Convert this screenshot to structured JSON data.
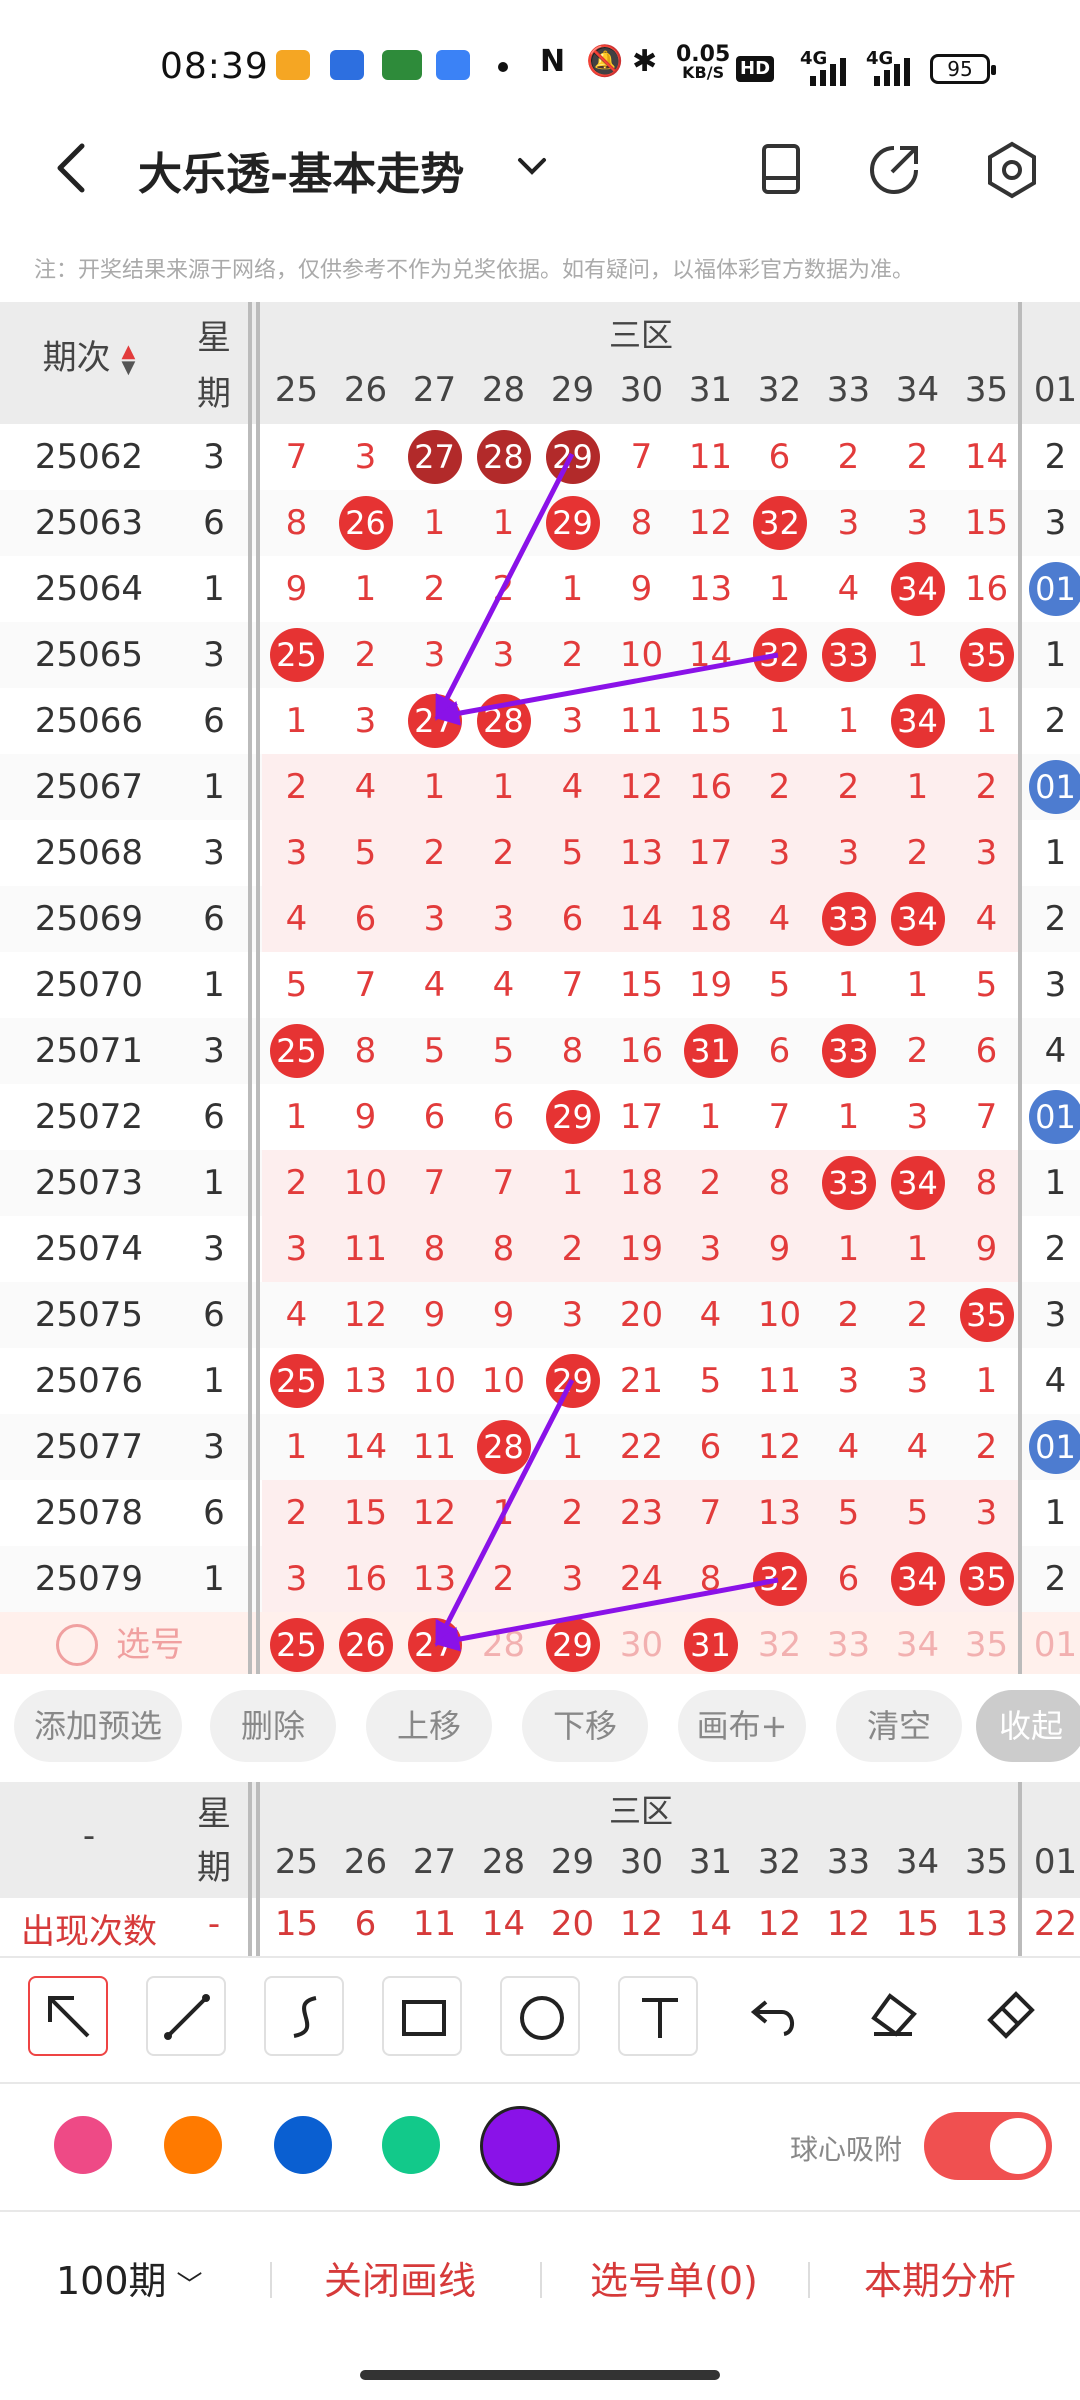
{
  "status_bar": {
    "time": "08:39",
    "net_speed_top": "0.05",
    "net_speed_bottom": "KB/S",
    "battery": "95",
    "hd": "HD",
    "signal1": "4G",
    "signal2": "4G"
  },
  "header": {
    "title": "大乐透-基本走势"
  },
  "notice": "注：开奖结果来源于网络，仅供参考不作为兑奖依据。如有疑问，以福体彩官方数据为准。",
  "table": {
    "col_issue": "期次",
    "col_week_1": "星",
    "col_week_2": "期",
    "zone": "三区",
    "columns": [
      "25",
      "26",
      "27",
      "28",
      "29",
      "30",
      "31",
      "32",
      "33",
      "34",
      "35",
      "01"
    ],
    "rows": [
      {
        "issue": "25062",
        "week": "3",
        "cells": [
          "7",
          "3",
          "27",
          "28",
          "29",
          "7",
          "11",
          "6",
          "2",
          "2",
          "14",
          "2"
        ]
      },
      {
        "issue": "25063",
        "week": "6",
        "cells": [
          "8",
          "26",
          "1",
          "1",
          "29",
          "8",
          "12",
          "32",
          "3",
          "3",
          "15",
          "3"
        ]
      },
      {
        "issue": "25064",
        "week": "1",
        "cells": [
          "9",
          "1",
          "2",
          "2",
          "1",
          "9",
          "13",
          "1",
          "4",
          "34",
          "16",
          "01"
        ]
      },
      {
        "issue": "25065",
        "week": "3",
        "cells": [
          "25",
          "2",
          "3",
          "3",
          "2",
          "10",
          "14",
          "32",
          "33",
          "1",
          "35",
          "1"
        ]
      },
      {
        "issue": "25066",
        "week": "6",
        "cells": [
          "1",
          "3",
          "27",
          "28",
          "3",
          "11",
          "15",
          "1",
          "1",
          "34",
          "1",
          "2"
        ]
      },
      {
        "issue": "25067",
        "week": "1",
        "cells": [
          "2",
          "4",
          "1",
          "1",
          "4",
          "12",
          "16",
          "2",
          "2",
          "1",
          "2",
          "01"
        ]
      },
      {
        "issue": "25068",
        "week": "3",
        "cells": [
          "3",
          "5",
          "2",
          "2",
          "5",
          "13",
          "17",
          "3",
          "3",
          "2",
          "3",
          "1"
        ]
      },
      {
        "issue": "25069",
        "week": "6",
        "cells": [
          "4",
          "6",
          "3",
          "3",
          "6",
          "14",
          "18",
          "4",
          "33",
          "34",
          "4",
          "2"
        ]
      },
      {
        "issue": "25070",
        "week": "1",
        "cells": [
          "5",
          "7",
          "4",
          "4",
          "7",
          "15",
          "19",
          "5",
          "1",
          "1",
          "5",
          "3"
        ]
      },
      {
        "issue": "25071",
        "week": "3",
        "cells": [
          "25",
          "8",
          "5",
          "5",
          "8",
          "16",
          "31",
          "6",
          "33",
          "2",
          "6",
          "4"
        ]
      },
      {
        "issue": "25072",
        "week": "6",
        "cells": [
          "1",
          "9",
          "6",
          "6",
          "29",
          "17",
          "1",
          "7",
          "1",
          "3",
          "7",
          "01"
        ]
      },
      {
        "issue": "25073",
        "week": "1",
        "cells": [
          "2",
          "10",
          "7",
          "7",
          "1",
          "18",
          "2",
          "8",
          "33",
          "34",
          "8",
          "1"
        ]
      },
      {
        "issue": "25074",
        "week": "3",
        "cells": [
          "3",
          "11",
          "8",
          "8",
          "2",
          "19",
          "3",
          "9",
          "1",
          "1",
          "9",
          "2"
        ]
      },
      {
        "issue": "25075",
        "week": "6",
        "cells": [
          "4",
          "12",
          "9",
          "9",
          "3",
          "20",
          "4",
          "10",
          "2",
          "2",
          "35",
          "3"
        ]
      },
      {
        "issue": "25076",
        "week": "1",
        "cells": [
          "25",
          "13",
          "10",
          "10",
          "29",
          "21",
          "5",
          "11",
          "3",
          "3",
          "1",
          "4"
        ]
      },
      {
        "issue": "25077",
        "week": "3",
        "cells": [
          "1",
          "14",
          "11",
          "28",
          "1",
          "22",
          "6",
          "12",
          "4",
          "4",
          "2",
          "01"
        ]
      },
      {
        "issue": "25078",
        "week": "6",
        "cells": [
          "2",
          "15",
          "12",
          "1",
          "2",
          "23",
          "7",
          "13",
          "5",
          "5",
          "3",
          "1"
        ]
      },
      {
        "issue": "25079",
        "week": "1",
        "cells": [
          "3",
          "16",
          "13",
          "2",
          "3",
          "24",
          "8",
          "32",
          "6",
          "34",
          "35",
          "2"
        ]
      }
    ],
    "select_label": "选号",
    "select_row": [
      "25",
      "26",
      "27",
      "28",
      "29",
      "30",
      "31",
      "32",
      "33",
      "34",
      "35",
      "01"
    ]
  },
  "actions": [
    "添加预选",
    "删除",
    "上移",
    "下移",
    "画布+",
    "清空",
    "收起"
  ],
  "stats": {
    "col_issue": "-",
    "col_week_1": "星",
    "col_week_2": "期",
    "zone": "三区",
    "row_label": "出现次数",
    "row_week": "-",
    "values": [
      "15",
      "6",
      "11",
      "14",
      "20",
      "12",
      "14",
      "12",
      "12",
      "15",
      "13",
      "22"
    ]
  },
  "colors": {
    "pink": "#ee4a86",
    "orange": "#ff7a00",
    "blue": "#0a5fd1",
    "green": "#12c98a",
    "purple": "#8a12e8"
  },
  "snap_label": "球心吸附",
  "bottom": {
    "period": "100期",
    "close_lines": "关闭画线",
    "select_list": "选号单(0)",
    "analysis": "本期分析"
  }
}
